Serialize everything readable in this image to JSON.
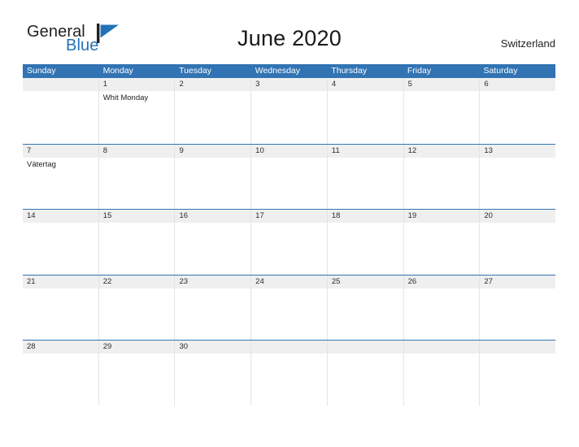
{
  "brand": {
    "name_part1": "General",
    "name_part2": "Blue",
    "flag_icon": "blue-triangle-flag-icon",
    "color_dark": "#231f20",
    "color_blue": "#2272b8"
  },
  "header": {
    "title": "June 2020",
    "region": "Switzerland"
  },
  "theme": {
    "header_blue": "#3173b3",
    "date_band_gray": "#efefef",
    "grid_line": "#e4e4e4",
    "week_separator": "#3173b3"
  },
  "calendar": {
    "weekdays": [
      "Sunday",
      "Monday",
      "Tuesday",
      "Wednesday",
      "Thursday",
      "Friday",
      "Saturday"
    ],
    "weeks": [
      [
        {
          "date": "",
          "events": []
        },
        {
          "date": "1",
          "events": [
            "Whit Monday"
          ]
        },
        {
          "date": "2",
          "events": []
        },
        {
          "date": "3",
          "events": []
        },
        {
          "date": "4",
          "events": []
        },
        {
          "date": "5",
          "events": []
        },
        {
          "date": "6",
          "events": []
        }
      ],
      [
        {
          "date": "7",
          "events": [
            "Vätertag"
          ]
        },
        {
          "date": "8",
          "events": []
        },
        {
          "date": "9",
          "events": []
        },
        {
          "date": "10",
          "events": []
        },
        {
          "date": "11",
          "events": []
        },
        {
          "date": "12",
          "events": []
        },
        {
          "date": "13",
          "events": []
        }
      ],
      [
        {
          "date": "14",
          "events": []
        },
        {
          "date": "15",
          "events": []
        },
        {
          "date": "16",
          "events": []
        },
        {
          "date": "17",
          "events": []
        },
        {
          "date": "18",
          "events": []
        },
        {
          "date": "19",
          "events": []
        },
        {
          "date": "20",
          "events": []
        }
      ],
      [
        {
          "date": "21",
          "events": []
        },
        {
          "date": "22",
          "events": []
        },
        {
          "date": "23",
          "events": []
        },
        {
          "date": "24",
          "events": []
        },
        {
          "date": "25",
          "events": []
        },
        {
          "date": "26",
          "events": []
        },
        {
          "date": "27",
          "events": []
        }
      ],
      [
        {
          "date": "28",
          "events": []
        },
        {
          "date": "29",
          "events": []
        },
        {
          "date": "30",
          "events": []
        },
        {
          "date": "",
          "events": []
        },
        {
          "date": "",
          "events": []
        },
        {
          "date": "",
          "events": []
        },
        {
          "date": "",
          "events": []
        }
      ]
    ]
  }
}
